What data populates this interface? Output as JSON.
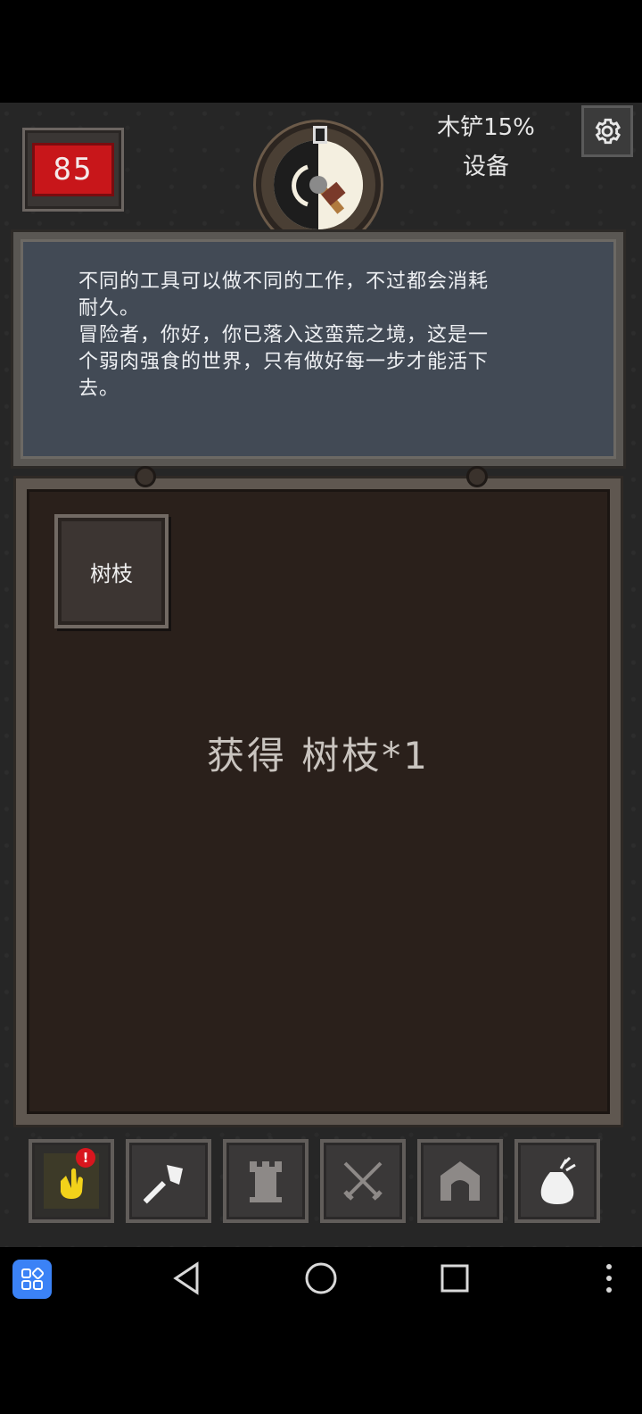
{
  "hud": {
    "hp_value": "85",
    "tool_status": "木铲15%",
    "equipment_label": "设备"
  },
  "message": {
    "lines": [
      "不同的工具可以做不同的工作，不过都会消耗",
      "耐久。",
      "冒险者，你好，你已落入这蛮荒之境，这是一",
      "个弱肉强食的世界，只有做好每一步才能活下",
      "去。"
    ]
  },
  "inventory": {
    "items": [
      {
        "label": "树枝"
      }
    ],
    "acquired_text": "获得  树枝*1"
  },
  "tabs": [
    {
      "icon": "hand-icon",
      "badge": "!",
      "active": true
    },
    {
      "icon": "axe-icon"
    },
    {
      "icon": "tower-icon"
    },
    {
      "icon": "crossed-swords-icon"
    },
    {
      "icon": "arch-gate-icon"
    },
    {
      "icon": "bag-icon"
    }
  ],
  "colors": {
    "hp_red": "#c8161a",
    "panel_blue": "#424a55",
    "inventory_brown": "#2a201b",
    "badge_red": "#d8161e",
    "hand_yellow": "#f2d21a",
    "apps_blue": "#3b82f6"
  }
}
